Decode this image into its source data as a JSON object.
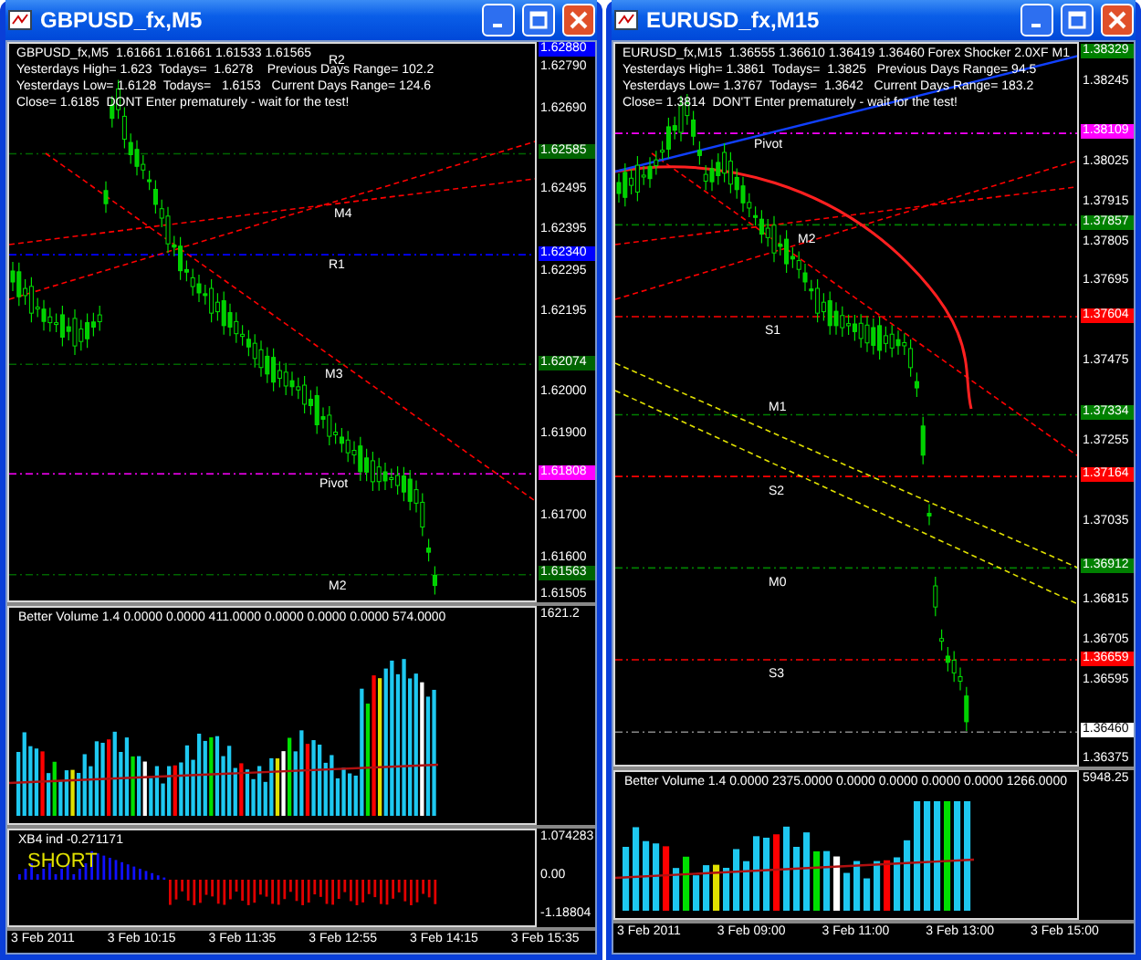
{
  "windows": [
    {
      "title": "GBPUSD_fx,M5",
      "main": {
        "info_lines": [
          "GBPUSD_fx,M5  1.61661 1.61661 1.61533 1.61565",
          "Yesterdays High= 1.623  Todays=  1.6278    Previous Days Range= 102.2",
          "Yesterdays Low= 1.6128  Todays=   1.6153   Current Days Range= 124.6",
          "Close= 1.6185  DONT Enter prematurely - wait for the test!"
        ],
        "level_labels": [
          "R2",
          "M4",
          "R1",
          "M3",
          "Pivot",
          "M2"
        ],
        "axis_ticks": [
          "1.62790",
          "1.62690",
          "1.62495",
          "1.62395",
          "1.62295",
          "1.62195",
          "1.62000",
          "1.61900",
          "1.61700",
          "1.61600",
          "1.61505"
        ],
        "price_tags": [
          {
            "text": "1.62880",
            "color": "#0000ff"
          },
          {
            "text": "1.62585",
            "color": "#006400"
          },
          {
            "text": "1.62340",
            "color": "#0000ff"
          },
          {
            "text": "1.62074",
            "color": "#006400"
          },
          {
            "text": "1.61808",
            "color": "#ff00ff"
          },
          {
            "text": "1.61563",
            "color": "#006400"
          }
        ]
      },
      "volume": {
        "header": "Better Volume 1.4 0.0000 0.0000 411.0000 0.0000 0.0000 0.0000 574.0000",
        "axis_ticks": [
          "1621.2"
        ]
      },
      "oscillator": {
        "header": "XB4 ind -0.271171",
        "signal": "SHORT",
        "axis_ticks": [
          "1.074283",
          "0.00",
          "-1.18804"
        ]
      },
      "time_axis": [
        "3 Feb 2011",
        "3 Feb 10:15",
        "3 Feb 11:35",
        "3 Feb 12:55",
        "3 Feb 14:15",
        "3 Feb 15:35"
      ]
    },
    {
      "title": "EURUSD_fx,M15",
      "main": {
        "info_lines": [
          "EURUSD_fx,M15  1.36555 1.36610 1.36419 1.36460",
          "Yesterdays High= 1.3861  Todays=  1.3825   Previous Days Range= 94.5",
          "Yesterdays Low= 1.3767  Todays=  1.3642   Current Days Range= 183.2",
          "Close= 1.3814  DON'T Enter prematurely - wait for the test!"
        ],
        "badge": "Forex Shocker 2.0XF M1",
        "level_labels": [
          "Pivot",
          "M2",
          "S1",
          "M1",
          "S2",
          "M0",
          "S3"
        ],
        "axis_ticks": [
          "1.38245",
          "1.38025",
          "1.37915",
          "1.37805",
          "1.37695",
          "1.37475",
          "1.37255",
          "1.37035",
          "1.36815",
          "1.36705",
          "1.36595",
          "1.36375"
        ],
        "price_tags": [
          {
            "text": "1.38329",
            "color": "#008000"
          },
          {
            "text": "1.38109",
            "color": "#ff00ff"
          },
          {
            "text": "1.37857",
            "color": "#008000"
          },
          {
            "text": "1.37604",
            "color": "#ff0000"
          },
          {
            "text": "1.37334",
            "color": "#008000"
          },
          {
            "text": "1.37164",
            "color": "#ff0000"
          },
          {
            "text": "1.36912",
            "color": "#008000"
          },
          {
            "text": "1.36659",
            "color": "#ff0000"
          },
          {
            "text": "1.36460",
            "color": "#ffffff"
          }
        ]
      },
      "volume": {
        "header": "Better Volume 1.4 0.0000 2375.0000 0.0000 0.0000 0.0000 0.0000 1266.0000",
        "axis_ticks": [
          "5948.25"
        ]
      },
      "time_axis": [
        "3 Feb 2011",
        "3 Feb 09:00",
        "3 Feb 11:00",
        "3 Feb 13:00",
        "3 Feb 15:00"
      ]
    }
  ]
}
